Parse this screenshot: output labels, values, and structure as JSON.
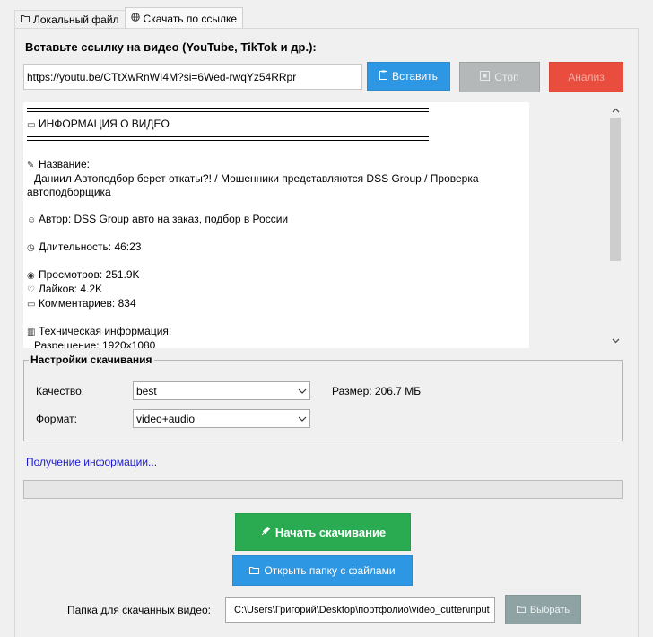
{
  "tabs": [
    {
      "label": "Локальный файл",
      "icon": "folder-icon"
    },
    {
      "label": "Скачать по ссылке",
      "icon": "globe-icon"
    }
  ],
  "url_section": {
    "label": "Вставьте ссылку на видео (YouTube, TikTok и др.):",
    "value": "https://youtu.be/CTtXwRnWI4M?si=6Wed-rwqYz54RRpr"
  },
  "buttons": {
    "paste": "Вставить",
    "stop": "Стоп",
    "analyze": "Анализ",
    "start": "Начать скачивание",
    "open_folder": "Открыть папку с файлами",
    "choose": "Выбрать"
  },
  "video_info": {
    "header": "ИНФОРМАЦИЯ О ВИДЕО",
    "title_label": "Название:",
    "title_line1": "Даниил Автоподбор берет откаты?! / Мошенники представляются DSS Group / Проверка",
    "title_line2": "автоподборщика",
    "author": "Автор: DSS Group авто на заказ, подбор в России",
    "duration": "Длительность: 46:23",
    "views": "Просмотров: 251.9K",
    "likes": "Лайков: 4.2K",
    "comments": "Комментариев: 834",
    "tech_label": "Техническая информация:",
    "resolution": "Разрешение: 1920x1080"
  },
  "settings": {
    "legend": "Настройки скачивания",
    "quality_label": "Качество:",
    "quality_value": "best",
    "size_label": "Размер: 206.7 МБ",
    "format_label": "Формат:",
    "format_value": "video+audio"
  },
  "status": {
    "text": "Получение информации...",
    "progress": 0
  },
  "folder": {
    "label": "Папка для скачанных видео:",
    "path": "C:\\Users\\Григорий\\Desktop\\портфолио\\video_cutter\\input"
  },
  "colors": {
    "paste": "#2e97e4",
    "stop": "#b4b8b8",
    "analyze": "#e94d3e",
    "start": "#2aab52",
    "choose": "#8fa3a5"
  }
}
